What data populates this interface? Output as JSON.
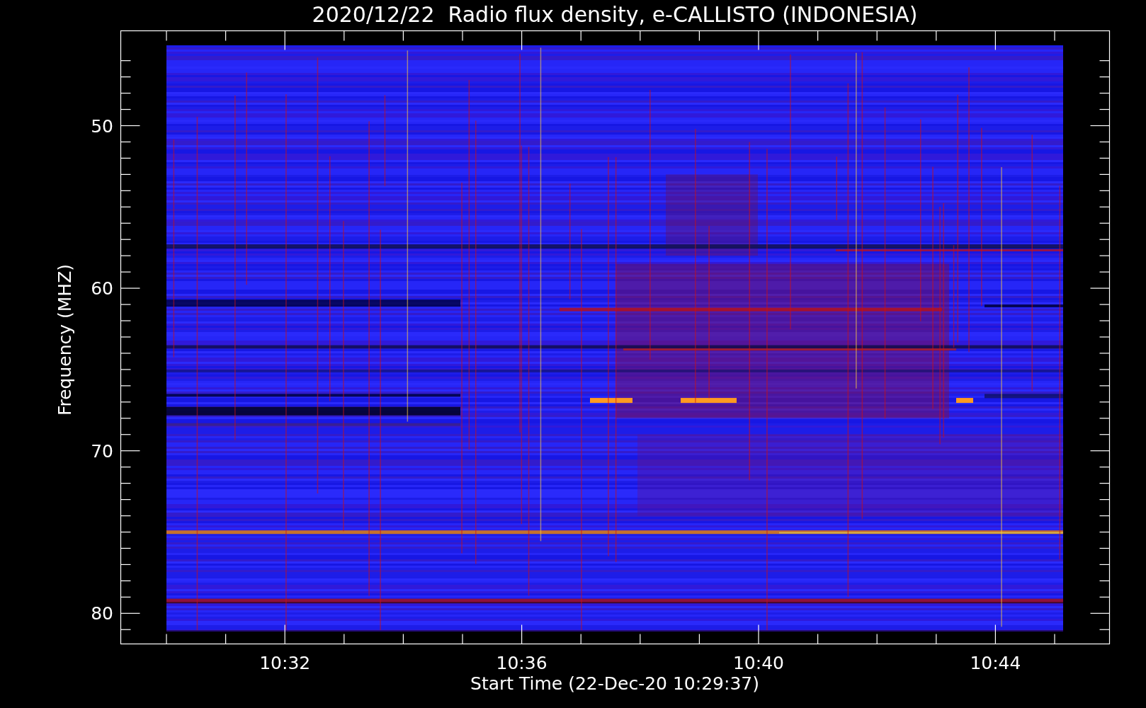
{
  "title": "2020/12/22  Radio flux density, e-CALLISTO (INDONESIA)",
  "ylabel": "Frequency (MHZ)",
  "xlabel": "Start Time (22-Dec-20 10:29:37)",
  "y_tick_labels": [
    "50",
    "60",
    "70",
    "80"
  ],
  "x_tick_labels": [
    "10:32",
    "10:36",
    "10:40",
    "10:44"
  ]
}
